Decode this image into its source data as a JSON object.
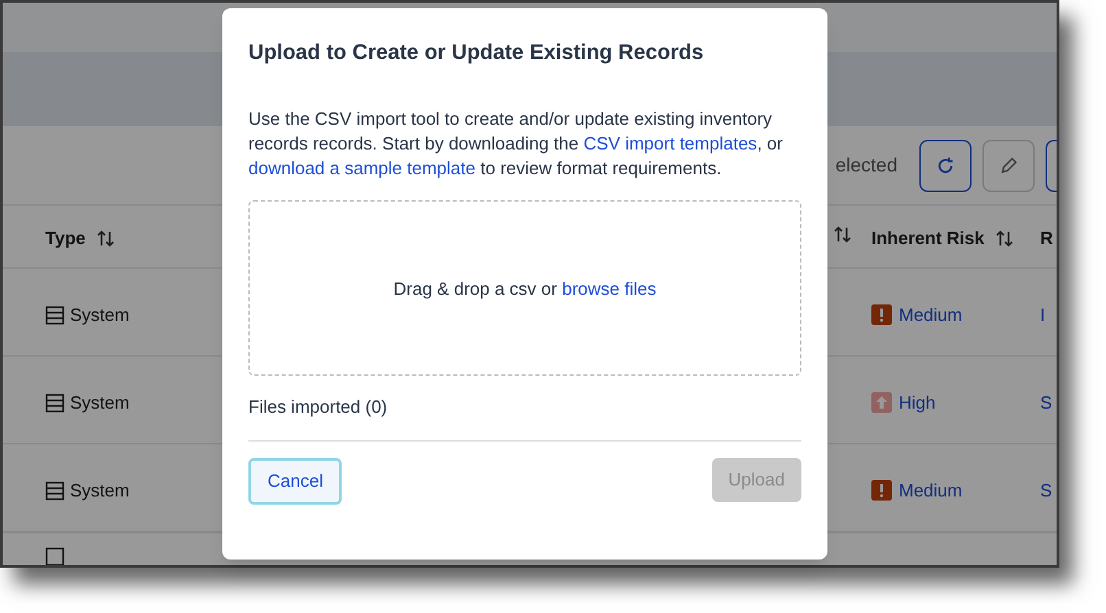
{
  "toolbar": {
    "selection_text": "elected"
  },
  "table": {
    "columns": [
      {
        "label": "Type",
        "sortable": true
      },
      {
        "sortable": true
      },
      {
        "label": "Inherent Risk",
        "sortable": true
      },
      {
        "label": "R",
        "sortable": false
      }
    ],
    "rows": [
      {
        "type": "System",
        "risk": "Medium",
        "kind": "medium",
        "column_4": "I"
      },
      {
        "type": "System",
        "risk": "High",
        "kind": "high",
        "column_4": "S"
      },
      {
        "type": "System",
        "risk": "Medium",
        "kind": "medium",
        "column_4": "S"
      }
    ]
  },
  "dialog": {
    "title": "Upload to Create or Update Existing Records",
    "description": [
      {
        "text": "Use the CSV import tool to create and/or update existing inventory records records. Start by downloading the ",
        "link": false
      },
      {
        "text": "CSV import templates",
        "link": true
      },
      {
        "text": ", or ",
        "link": false
      },
      {
        "text": "download a sample template",
        "link": true
      },
      {
        "text": " to review format requirements.",
        "link": false
      }
    ],
    "dropzone": {
      "text": "Drag & drop a csv or ",
      "link": "browse files"
    },
    "files_imported": "Files imported (0)",
    "buttons": [
      {
        "label": "Cancel",
        "kind": "secondary",
        "disabled": false
      },
      {
        "label": "Upload",
        "kind": "primary",
        "disabled": true
      }
    ]
  }
}
